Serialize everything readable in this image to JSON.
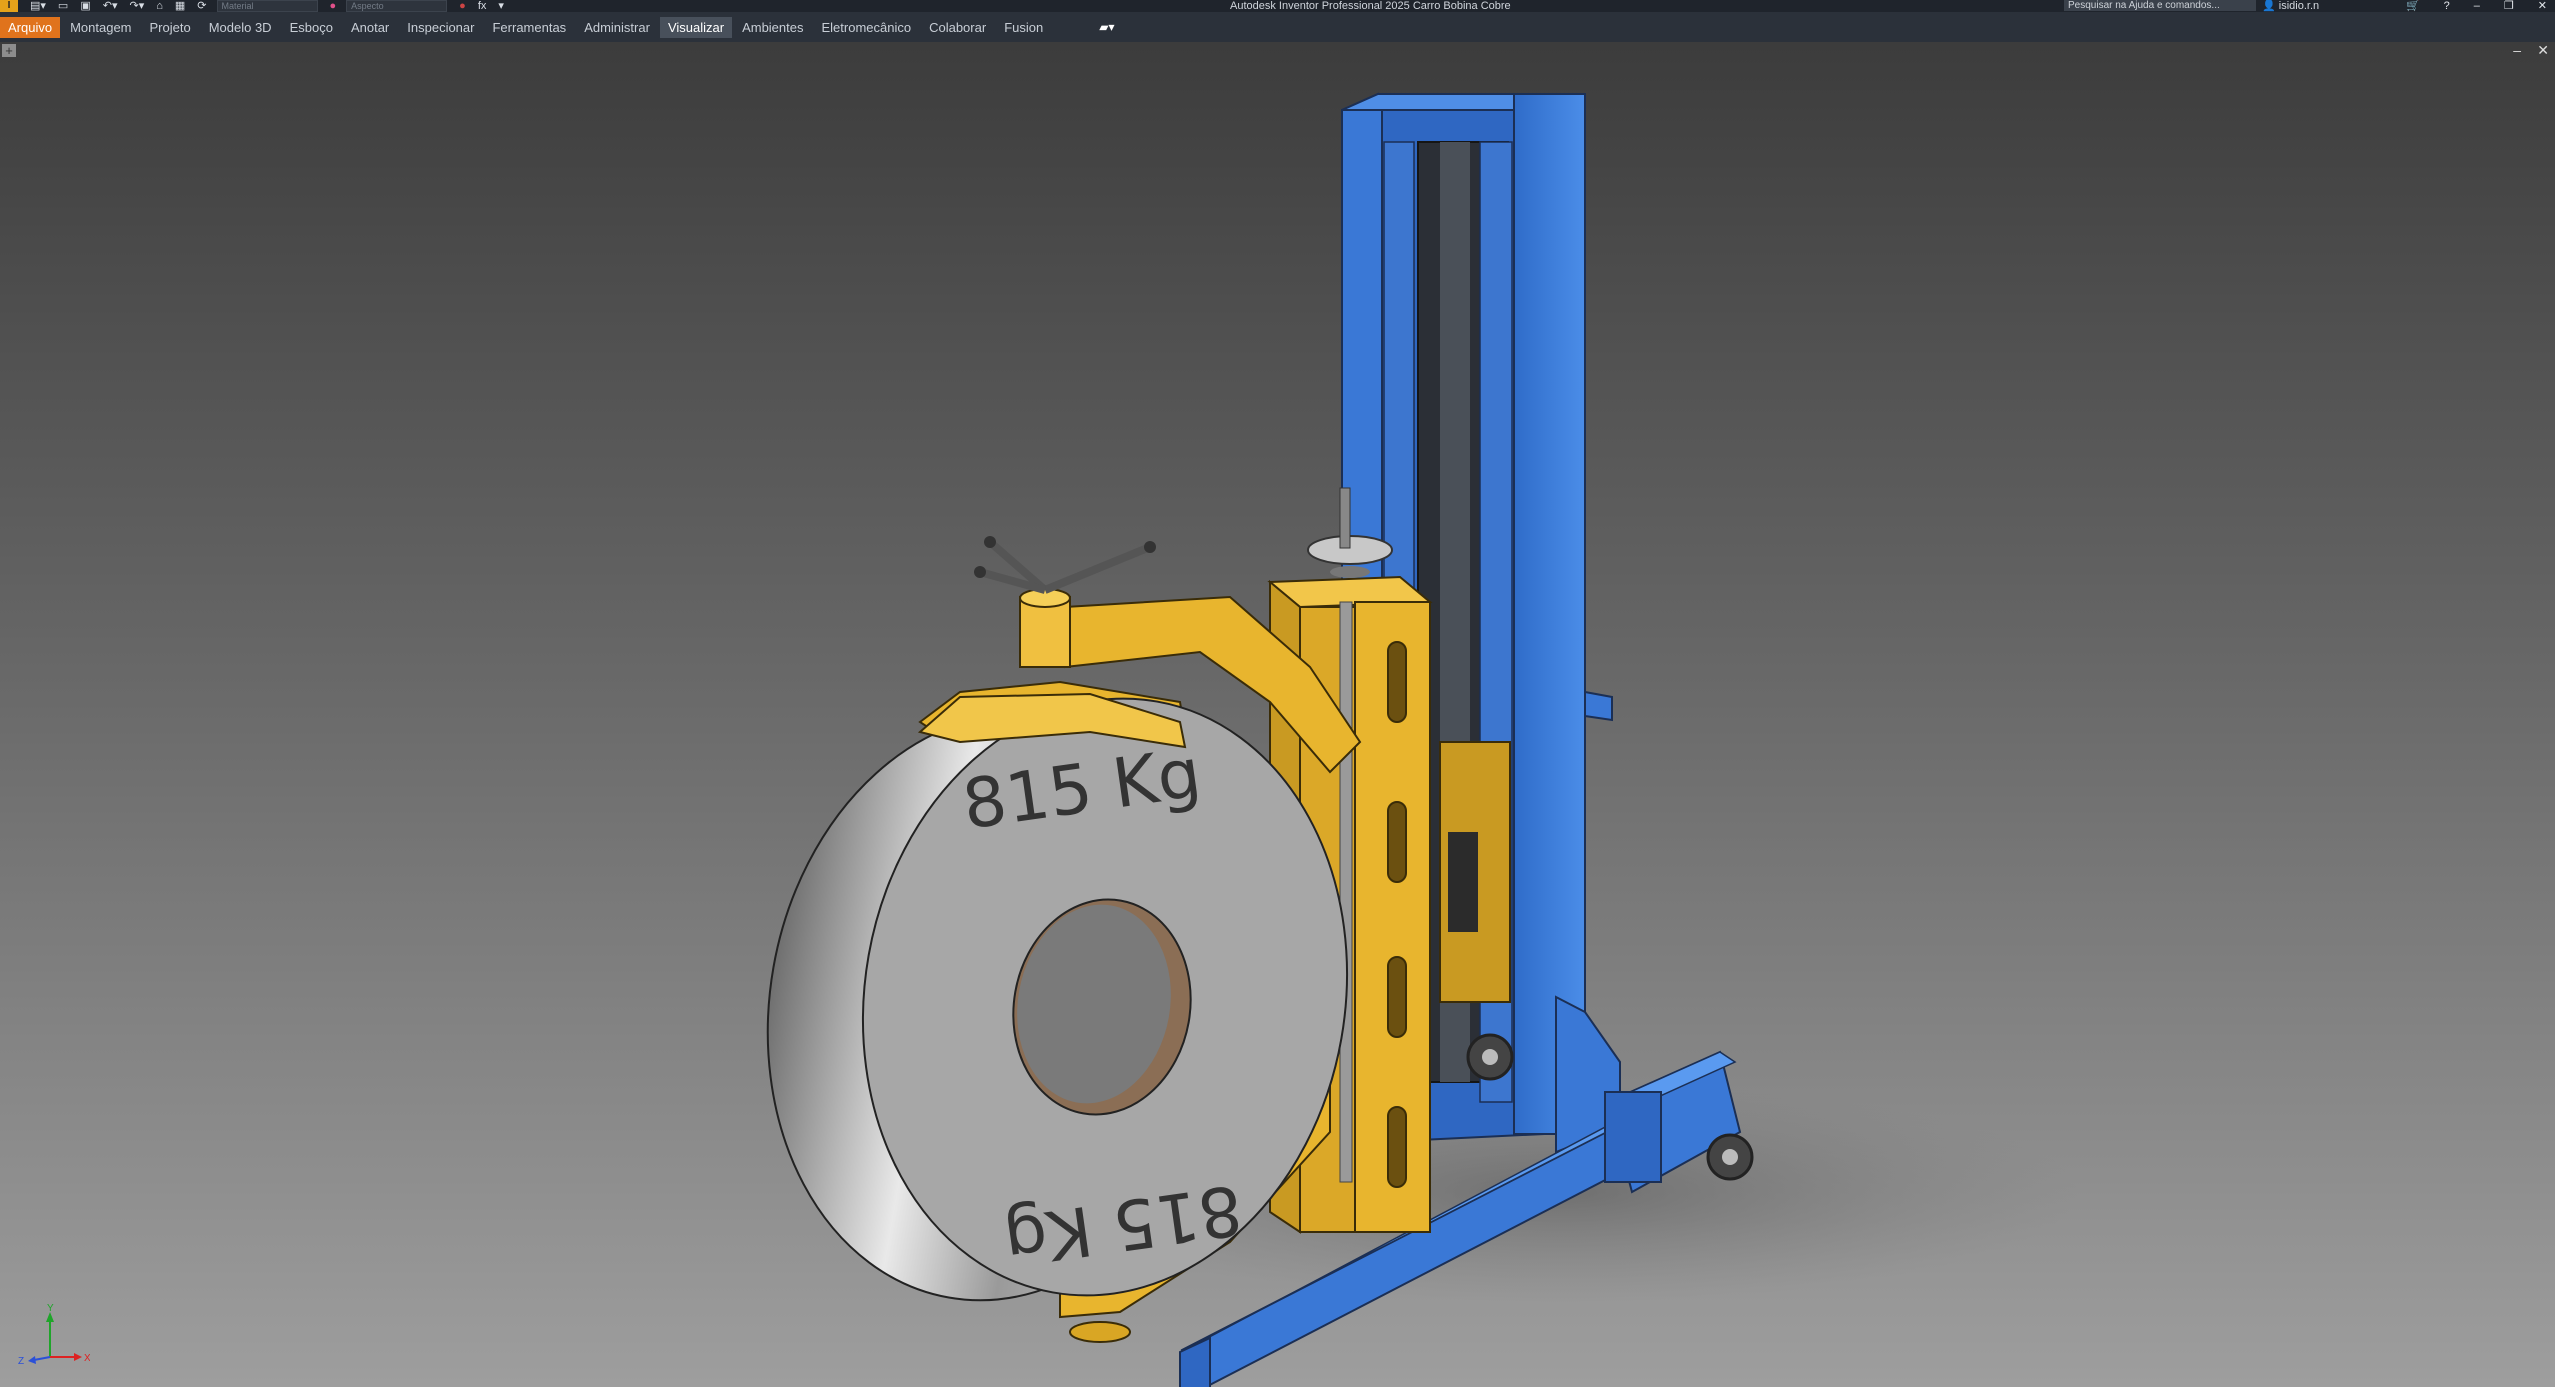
{
  "app": {
    "logo": "I",
    "window_title": "Autodesk Inventor Professional 2025   Carro Bobina Cobre",
    "search_placeholder": "Pesquisar na Ajuda e comandos...",
    "user": "isidio.r.n"
  },
  "quick_access": {
    "material_placeholder": "Material",
    "appearance_placeholder": "Aspecto",
    "fx_label": "fx"
  },
  "ribbon_tabs": [
    {
      "label": "Arquivo"
    },
    {
      "label": "Montagem"
    },
    {
      "label": "Projeto"
    },
    {
      "label": "Modelo 3D"
    },
    {
      "label": "Esboço"
    },
    {
      "label": "Anotar"
    },
    {
      "label": "Inspecionar"
    },
    {
      "label": "Ferramentas"
    },
    {
      "label": "Administrar"
    },
    {
      "label": "Visualizar"
    },
    {
      "label": "Ambientes"
    },
    {
      "label": "Eletromecânico"
    },
    {
      "label": "Colaborar"
    },
    {
      "label": "Fusion"
    }
  ],
  "active_tab": "Visualizar",
  "model": {
    "coil_label_top": "815 Kg",
    "coil_label_bottom": "815 Kg"
  },
  "triad": {
    "x": "X",
    "y": "Y",
    "z": "Z"
  },
  "colors": {
    "frame_blue": "#3a78d6",
    "arm_yellow": "#e8b52e",
    "coil_grey": "#a9a9a9",
    "file_tab": "#e0731c"
  }
}
